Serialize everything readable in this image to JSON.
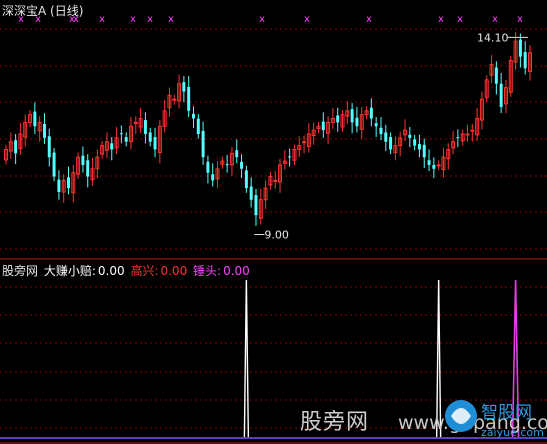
{
  "header": {
    "title": "深深宝A",
    "period": "(日线)"
  },
  "indicator_bar": {
    "site": "股旁网",
    "items": [
      {
        "label": "大赚小赔:",
        "value": "0.00",
        "color": "#ffffff"
      },
      {
        "label": "高兴:",
        "value": "0.00",
        "color": "#ff3030"
      },
      {
        "label": "锤头:",
        "value": "0.00",
        "color": "#ff40ff"
      }
    ]
  },
  "annotations": {
    "high_label": "14.10",
    "low_label": "9.00",
    "top_markers": "x"
  },
  "watermark": {
    "left": "股旁网",
    "right": "www.gupang.com"
  },
  "logo": {
    "text_main": "智股网",
    "text_sub": "zaiyue.com"
  },
  "colors": {
    "up": "#ff3232",
    "down": "#54ffff",
    "grid": "#8b0000",
    "sep": "#b02020",
    "marker": "#ff40ff",
    "signal_white": "#ffffff",
    "signal_magenta": "#e040e0"
  },
  "chart_data": [
    {
      "type": "candlestick",
      "title": "深深宝A (日线)",
      "ylim": [
        8.6,
        14.6
      ],
      "high_label": 14.1,
      "low_label": 9.0,
      "close": [
        11.2,
        11.4,
        11.1,
        11.6,
        11.9,
        12.1,
        11.8,
        11.9,
        11.5,
        11.0,
        10.5,
        10.1,
        10.4,
        10.2,
        10.6,
        11.0,
        10.8,
        10.5,
        10.7,
        11.0,
        11.3,
        11.4,
        11.2,
        11.5,
        11.6,
        11.4,
        11.8,
        11.9,
        12.0,
        11.6,
        11.4,
        11.2,
        11.8,
        12.2,
        12.6,
        12.5,
        12.9,
        12.7,
        12.2,
        12.0,
        11.6,
        11.0,
        10.6,
        10.4,
        10.7,
        10.9,
        10.8,
        11.1,
        11.0,
        10.7,
        10.2,
        9.9,
        9.5,
        9.9,
        10.2,
        10.5,
        10.4,
        10.8,
        10.9,
        11.0,
        11.2,
        11.3,
        11.4,
        11.6,
        11.7,
        11.8,
        11.7,
        11.9,
        12.0,
        11.9,
        12.1,
        12.2,
        11.9,
        11.8,
        12.1,
        12.2,
        12.0,
        11.8,
        11.6,
        11.4,
        11.2,
        11.3,
        11.5,
        11.7,
        11.5,
        11.3,
        11.2,
        11.0,
        10.8,
        10.7,
        10.8,
        11.0,
        11.2,
        11.4,
        11.5,
        11.6,
        11.6,
        11.7,
        12.0,
        12.5,
        13.0,
        13.4,
        12.9,
        12.3,
        12.8,
        13.5,
        14.0,
        13.6,
        13.3,
        13.7
      ]
    },
    {
      "type": "line",
      "title": "大赚小赔 / 高兴 / 锤头",
      "series": [
        {
          "name": "大赚小赔",
          "values": [
            0,
            0,
            0,
            0,
            0,
            0,
            0,
            0,
            0,
            0,
            0,
            0,
            0,
            0,
            0,
            0,
            0,
            0,
            0,
            0,
            0,
            0,
            0,
            0,
            0,
            0,
            0,
            0,
            0,
            0,
            0,
            0,
            0,
            0,
            0,
            0,
            0,
            0,
            0,
            0,
            0,
            0,
            0,
            0,
            0,
            0,
            0,
            0,
            0,
            0,
            1,
            0,
            0,
            0,
            0,
            0,
            0,
            0,
            0,
            0,
            0,
            0,
            0,
            0,
            0,
            0,
            0,
            0,
            0,
            0,
            0,
            0,
            0,
            0,
            0,
            0,
            0,
            0,
            0,
            0,
            0,
            0,
            0,
            0,
            0,
            0,
            0,
            0,
            0,
            0,
            1,
            0,
            0,
            0,
            0,
            0,
            0,
            0,
            0,
            0,
            0,
            0,
            0,
            0,
            0,
            0,
            0,
            0,
            0,
            0
          ]
        },
        {
          "name": "高兴",
          "values": [
            0
          ]
        },
        {
          "name": "锤头",
          "values": [
            0,
            0,
            0,
            0,
            0,
            0,
            0,
            0,
            0,
            0,
            0,
            0,
            0,
            0,
            0,
            0,
            0,
            0,
            0,
            0,
            0,
            0,
            0,
            0,
            0,
            0,
            0,
            0,
            0,
            0,
            0,
            0,
            0,
            0,
            0,
            0,
            0,
            0,
            0,
            0,
            0,
            0,
            0,
            0,
            0,
            0,
            0,
            0,
            0,
            0,
            0,
            0,
            0,
            0,
            0,
            0,
            0,
            0,
            0,
            0,
            0,
            0,
            0,
            0,
            0,
            0,
            0,
            0,
            0,
            0,
            0,
            0,
            0,
            0,
            0,
            0,
            0,
            0,
            0,
            0,
            0,
            0,
            0,
            0,
            0,
            0,
            0,
            0,
            0,
            0,
            0,
            0,
            0,
            0,
            0,
            0,
            0,
            0,
            0,
            0,
            0,
            0,
            0,
            0,
            0,
            0,
            1,
            0,
            0,
            0
          ]
        }
      ]
    }
  ]
}
